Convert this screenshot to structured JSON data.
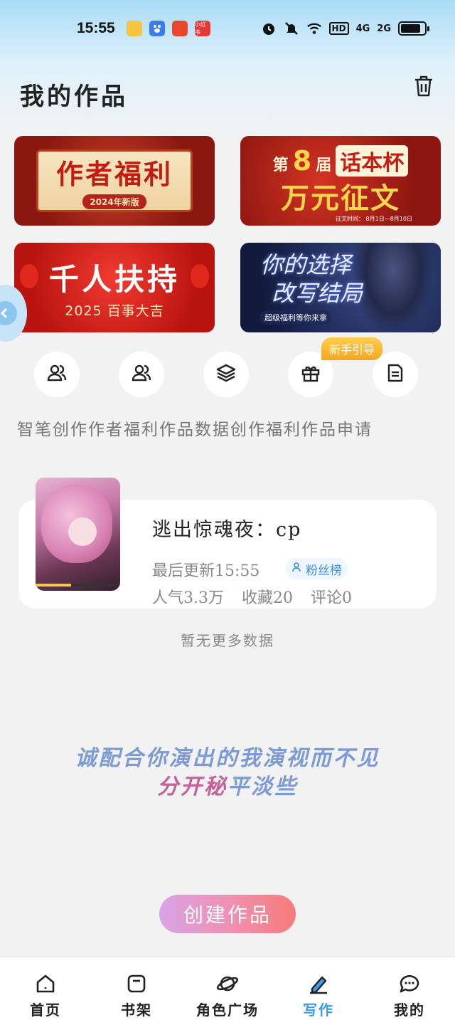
{
  "status_bar": {
    "time": "15:55",
    "apps": [
      {
        "icon": "app-icon-1",
        "color": "#f6c542"
      },
      {
        "icon": "baidu-icon",
        "color": "#3a7bef"
      },
      {
        "icon": "app-icon-3",
        "color": "#e8472c"
      },
      {
        "icon": "app-icon-4",
        "color": "#e53935",
        "label": "小红书"
      }
    ],
    "indicators": [
      "alarm-icon",
      "mute-icon",
      "wifi-icon"
    ],
    "hd_label": "HD",
    "net1": "4G",
    "net2": "2G",
    "battery_level": 0.85
  },
  "header": {
    "title": "我的作品"
  },
  "banners": [
    {
      "main": "作者福利",
      "sub": "2024年新版"
    },
    {
      "prefix": "第",
      "num": "8",
      "suffix": "届",
      "cup": "话本杯",
      "main": "万元征文",
      "note": "征文时间： 8月1日—8月10日"
    },
    {
      "main": "千人扶持",
      "sub": "2025 百事大吉"
    },
    {
      "main1": "你的选择",
      "main2": "改写结局",
      "sub": "超级福利等你来拿"
    }
  ],
  "guide_badge": "新手引导",
  "quick_labels": "智笔创作作者福利作品数据创作福利作品申请",
  "work": {
    "title": "逃出惊魂夜：cp",
    "updated": "最后更新15:55",
    "fans_label": "粉丝榜",
    "popularity": "人气3.3万",
    "favorites": "收藏20",
    "comments": "评论0"
  },
  "no_more": "暂无更多数据",
  "slogan": {
    "line1": "诚配合你演出的我演视而不见",
    "line2_pink": "分开秘",
    "line2_blue": "平淡些"
  },
  "create_button": "创建作品",
  "nav": [
    {
      "label": "首页",
      "icon": "home-icon"
    },
    {
      "label": "书架",
      "icon": "bookshelf-icon"
    },
    {
      "label": "角色广场",
      "icon": "planet-icon"
    },
    {
      "label": "写作",
      "icon": "pen-icon",
      "active": true
    },
    {
      "label": "我的",
      "icon": "chat-icon"
    }
  ],
  "colors": {
    "accent": "#3a9be6",
    "create_gradient_start": "#d9a3e6",
    "create_gradient_end": "#f77a7a"
  }
}
